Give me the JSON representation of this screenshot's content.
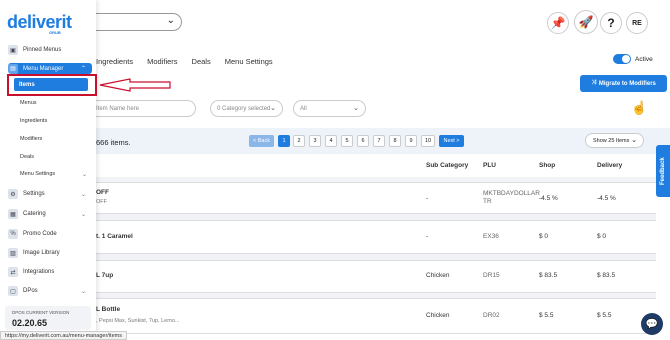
{
  "brand": {
    "logo": "deliverit",
    "logo_sub": "GRUB"
  },
  "sidebar": {
    "pinned": "Pinned Menus",
    "menu_manager": "Menu Manager",
    "sub_items": [
      "Items",
      "Menus",
      "Ingredients",
      "Modifiers",
      "Deals",
      "Menu Settings"
    ],
    "settings": "Settings",
    "catering": "Catering",
    "promo": "Promo Code",
    "image_library": "Image Library",
    "integrations": "Integrations",
    "dpos": "DPos",
    "version_label": "DPOS CURRENT VERSION",
    "version": "02.20.65"
  },
  "header": {
    "user_initials": "RE",
    "help": "?"
  },
  "tabs": [
    "Ingredients",
    "Modifiers",
    "Deals",
    "Menu Settings"
  ],
  "active_toggle": "Active",
  "migrate_label": "Migrate to Modifiers",
  "filters": {
    "search_placeholder": "Item Name here",
    "category": "0 Category selected",
    "all": "All"
  },
  "items_count": "666 items.",
  "pagination": {
    "back": "< Back",
    "pages": [
      "1",
      "2",
      "3",
      "4",
      "5",
      "6",
      "7",
      "8",
      "9",
      "10"
    ],
    "next": "Next >",
    "show": "Show 25 Items"
  },
  "table": {
    "headers": {
      "sub_category": "Sub Category",
      "plu": "PLU",
      "shop": "Shop",
      "delivery": "Delivery"
    },
    "rows": [
      {
        "name": "OFF",
        "sub": "OFF",
        "sub_category": "-",
        "plu": "MKTBDAYDOLLAR TR",
        "shop": "-4.5 %",
        "delivery": "-4.5 %"
      },
      {
        "name": "t. 1 Caramel",
        "sub": "",
        "sub_category": "-",
        "plu": "EX36",
        "shop": "$ 0",
        "delivery": "$ 0"
      },
      {
        "name": "L 7up",
        "sub": "",
        "sub_category": "Chicken",
        "plu": "DR15",
        "shop": "$ 83.5",
        "delivery": "$ 83.5"
      },
      {
        "name": "L Bottle",
        "sub": ", Pepsi Max, Sunkist, 7up, Lemo...",
        "sub_category": "Chicken",
        "plu": "DR02",
        "shop": "$ 5.5",
        "delivery": "$ 5.5"
      }
    ]
  },
  "feedback": "Feedback",
  "status_url": "https://my.deliverit.com.au/menu-manager/items",
  "colors": {
    "primary": "#1f7de0",
    "highlight": "#c8102e",
    "dark": "#1e3a66"
  }
}
